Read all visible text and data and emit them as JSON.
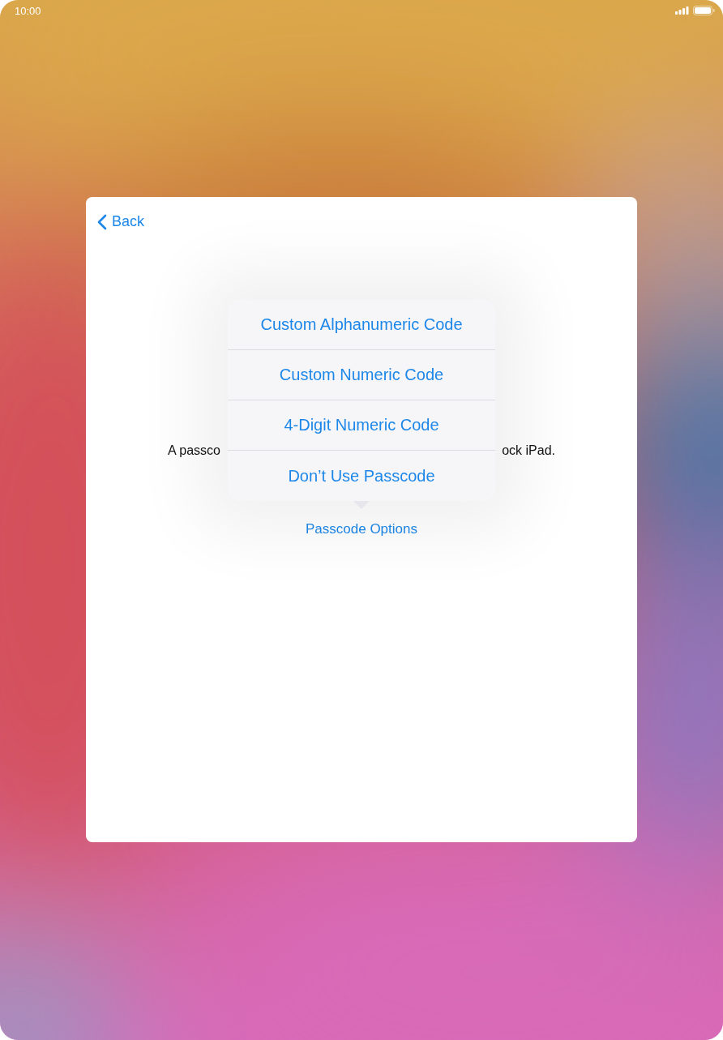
{
  "status_bar": {
    "time": "10:00"
  },
  "card": {
    "back": "Back",
    "description_left": "A passco",
    "description_right": "ock iPad.",
    "options_link": "Passcode Options"
  },
  "popover": {
    "items": [
      "Custom Alphanumeric Code",
      "Custom Numeric Code",
      "4-Digit Numeric Code",
      "Don’t Use Passcode"
    ]
  }
}
